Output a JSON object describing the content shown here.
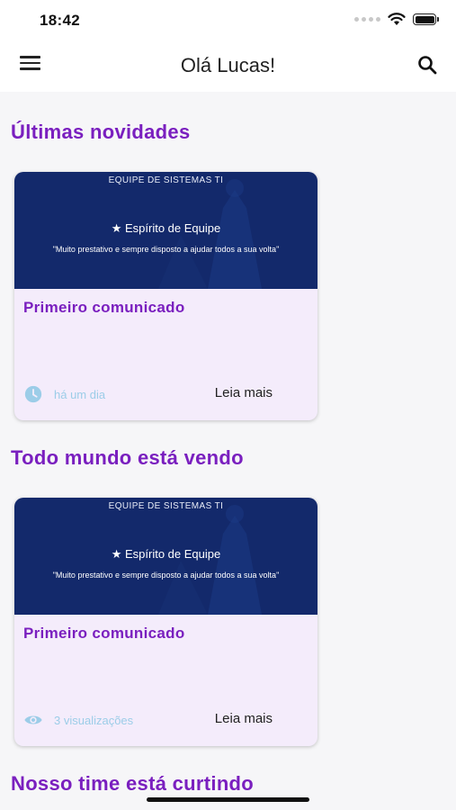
{
  "status_bar": {
    "time": "18:42"
  },
  "app_bar": {
    "title": "Olá Lucas!",
    "menu_icon": "menu-icon",
    "search_icon": "search-icon"
  },
  "sections": [
    {
      "title": "Últimas novidades",
      "card": {
        "banner_header": "EQUIPE DE SISTEMAS TI",
        "banner_award": "★ Espírito de Equipe",
        "banner_quote": "\"Muito prestativo e sempre disposto a ajudar todos a sua volta\"",
        "title": "Primeiro comunicado",
        "meta_icon": "clock-icon",
        "meta_text": "há um dia",
        "action": "Leia mais"
      }
    },
    {
      "title": "Todo mundo está vendo",
      "card": {
        "banner_header": "EQUIPE DE SISTEMAS TI",
        "banner_award": "★ Espírito de Equipe",
        "banner_quote": "\"Muito prestativo e sempre disposto a ajudar todos a sua volta\"",
        "title": "Primeiro comunicado",
        "meta_icon": "eye-icon",
        "meta_text": "3 visualizações",
        "action": "Leia mais"
      }
    },
    {
      "title": "Nosso time está curtindo"
    }
  ],
  "colors": {
    "accent": "#7a1fbf",
    "banner": "#13296b",
    "card_bg": "#f4ecfb",
    "meta": "#9ccde8"
  }
}
